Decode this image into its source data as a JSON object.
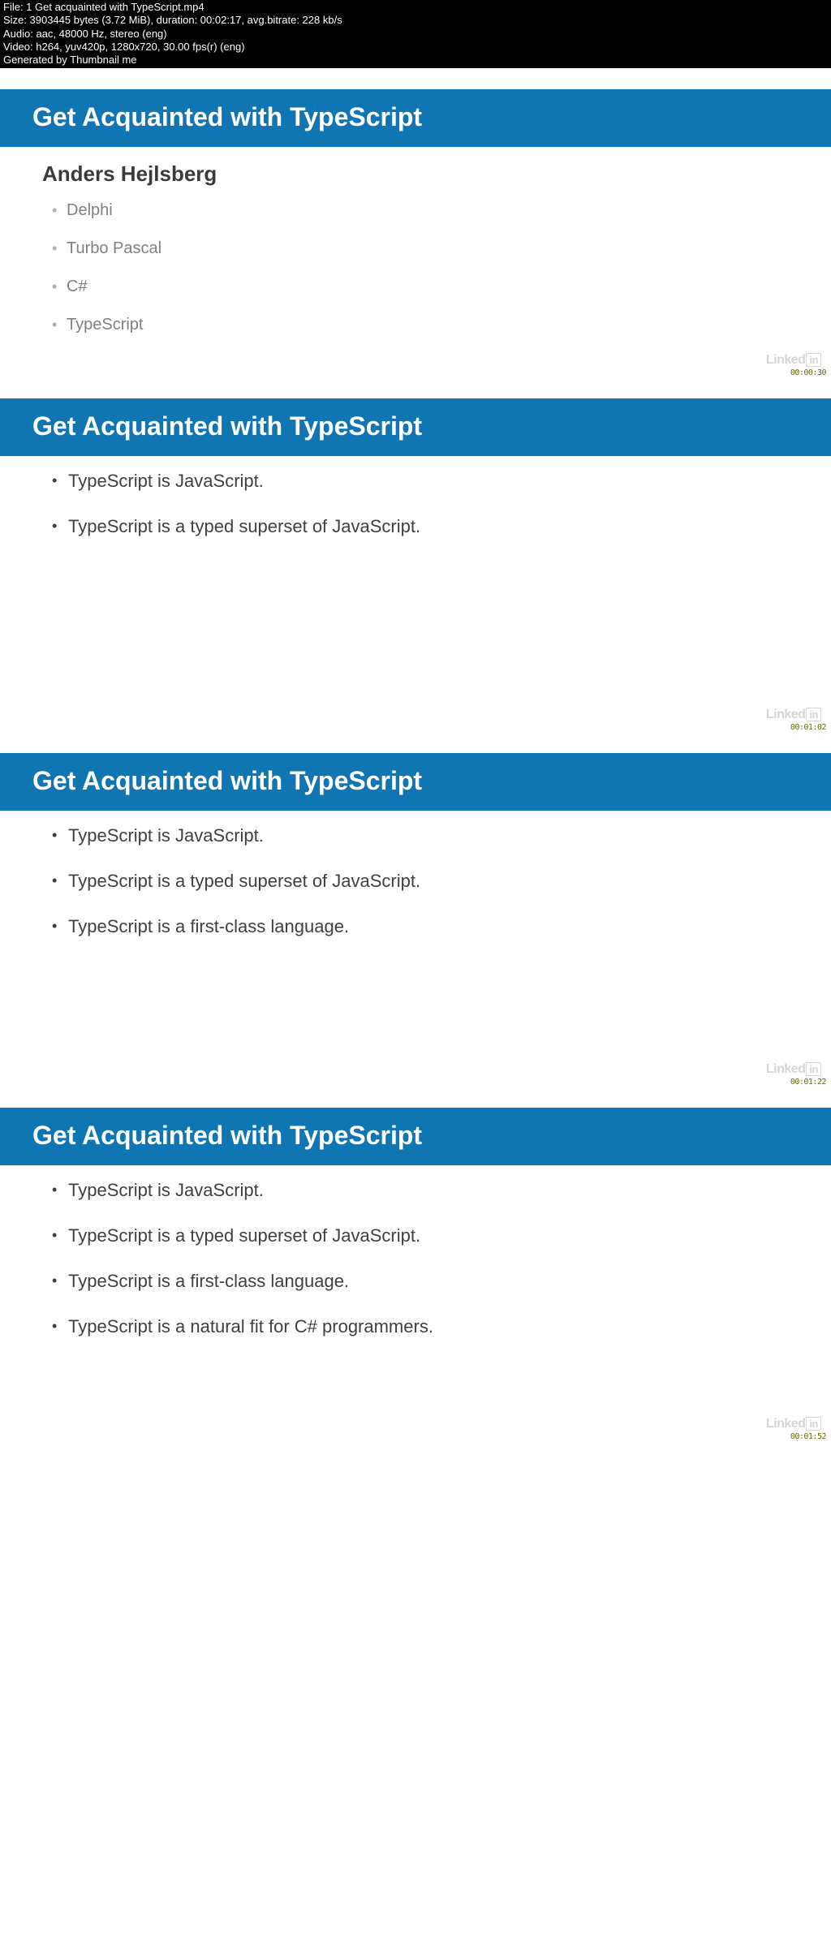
{
  "meta": {
    "file": "File: 1 Get acquainted with TypeScript.mp4",
    "size": "Size: 3903445 bytes (3.72 MiB), duration: 00:02:17, avg.bitrate: 228 kb/s",
    "audio": "Audio: aac, 48000 Hz, stereo (eng)",
    "video": "Video: h264, yuv420p, 1280x720, 30.00 fps(r) (eng)",
    "generated": "Generated by Thumbnail me"
  },
  "slides": [
    {
      "title": "Get Acquainted with TypeScript",
      "subheading": "Anders Hejlsberg",
      "bullets_style": "gray",
      "bullets": [
        "Delphi",
        "Turbo Pascal",
        "C#",
        "TypeScript"
      ],
      "timestamp": "00:00:30"
    },
    {
      "title": "Get Acquainted with TypeScript",
      "bullets_style": "dark",
      "bullets": [
        "TypeScript is JavaScript.",
        "TypeScript is a typed superset of JavaScript."
      ],
      "timestamp": "00:01:02"
    },
    {
      "title": "Get Acquainted with TypeScript",
      "bullets_style": "dark",
      "bullets": [
        "TypeScript is JavaScript.",
        "TypeScript is a typed superset of JavaScript.",
        "TypeScript is a first-class language."
      ],
      "timestamp": "00:01:22"
    },
    {
      "title": "Get Acquainted with TypeScript",
      "bullets_style": "dark",
      "bullets": [
        "TypeScript is JavaScript.",
        "TypeScript is a typed superset of JavaScript.",
        "TypeScript is a first-class language.",
        "TypeScript is a natural fit for C# programmers."
      ],
      "timestamp": "00:01:52"
    }
  ],
  "watermark": {
    "brand1": "Linked",
    "brand2": "in"
  }
}
